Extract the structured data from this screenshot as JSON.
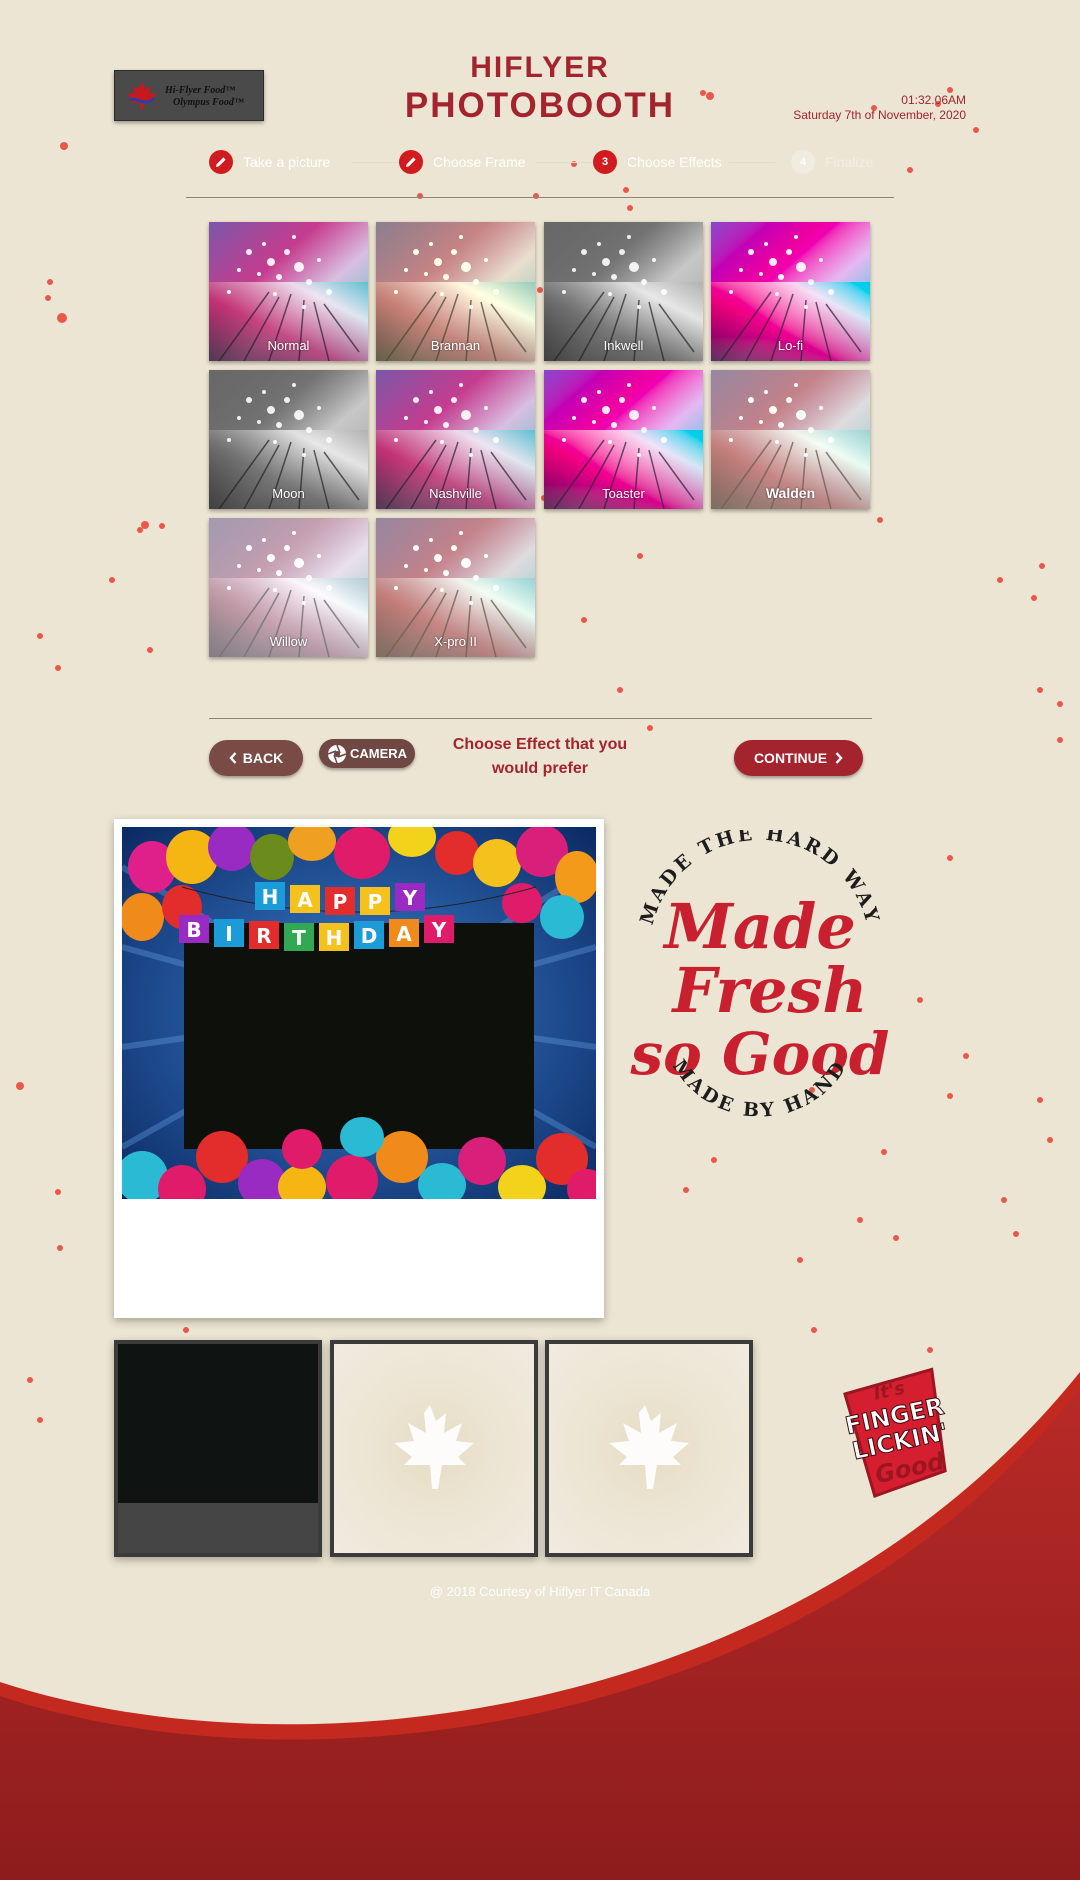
{
  "header": {
    "logo_line1": "Hi-Flyer Food™",
    "logo_line2": "Olympus Food™",
    "title_line1": "HIFLYER",
    "title_line2": "PHOTOBOOTH",
    "time": "01:32.06AM",
    "date": "Saturday 7th of November, 2020"
  },
  "stepper": {
    "steps": [
      {
        "label": "Take a picture",
        "icon": "pencil-icon",
        "state": "done"
      },
      {
        "label": "Choose Frame",
        "icon": "pencil-icon",
        "state": "done"
      },
      {
        "number": "3",
        "label": "Choose Effects",
        "state": "active"
      },
      {
        "number": "4",
        "label": "Finalize",
        "state": "disabled"
      }
    ]
  },
  "effects": [
    "Normal",
    "Brannan",
    "Inkwell",
    "Lo-fi",
    "Moon",
    "Nashville",
    "Toaster",
    "Walden",
    "Willow",
    "X-pro II"
  ],
  "actions": {
    "back_label": "BACK",
    "camera_label": "CAMERA",
    "hint": "Choose Effect that you would prefer",
    "continue_label": "CONTINUE"
  },
  "preview": {
    "frame_banner_line1": [
      "H",
      "A",
      "P",
      "P",
      "Y"
    ],
    "frame_banner_line2": [
      "B",
      "I",
      "R",
      "T",
      "H",
      "D",
      "A",
      "Y"
    ]
  },
  "badge": {
    "top_text": "MADE THE HARD WAY",
    "script_line1": "Made",
    "script_line2": "Fresh",
    "script_line3": "so Good",
    "bottom_text": "MADE BY HAND"
  },
  "finger": {
    "line1": "It's",
    "line2": "FINGER",
    "line3": "LICKIN'",
    "line4": "Good"
  },
  "footer": "@ 2018 Courtesy of Hiflyer IT Canada",
  "colors": {
    "brand": "#a4242d",
    "background": "#ece5d3",
    "back_button": "#7a4a45"
  }
}
